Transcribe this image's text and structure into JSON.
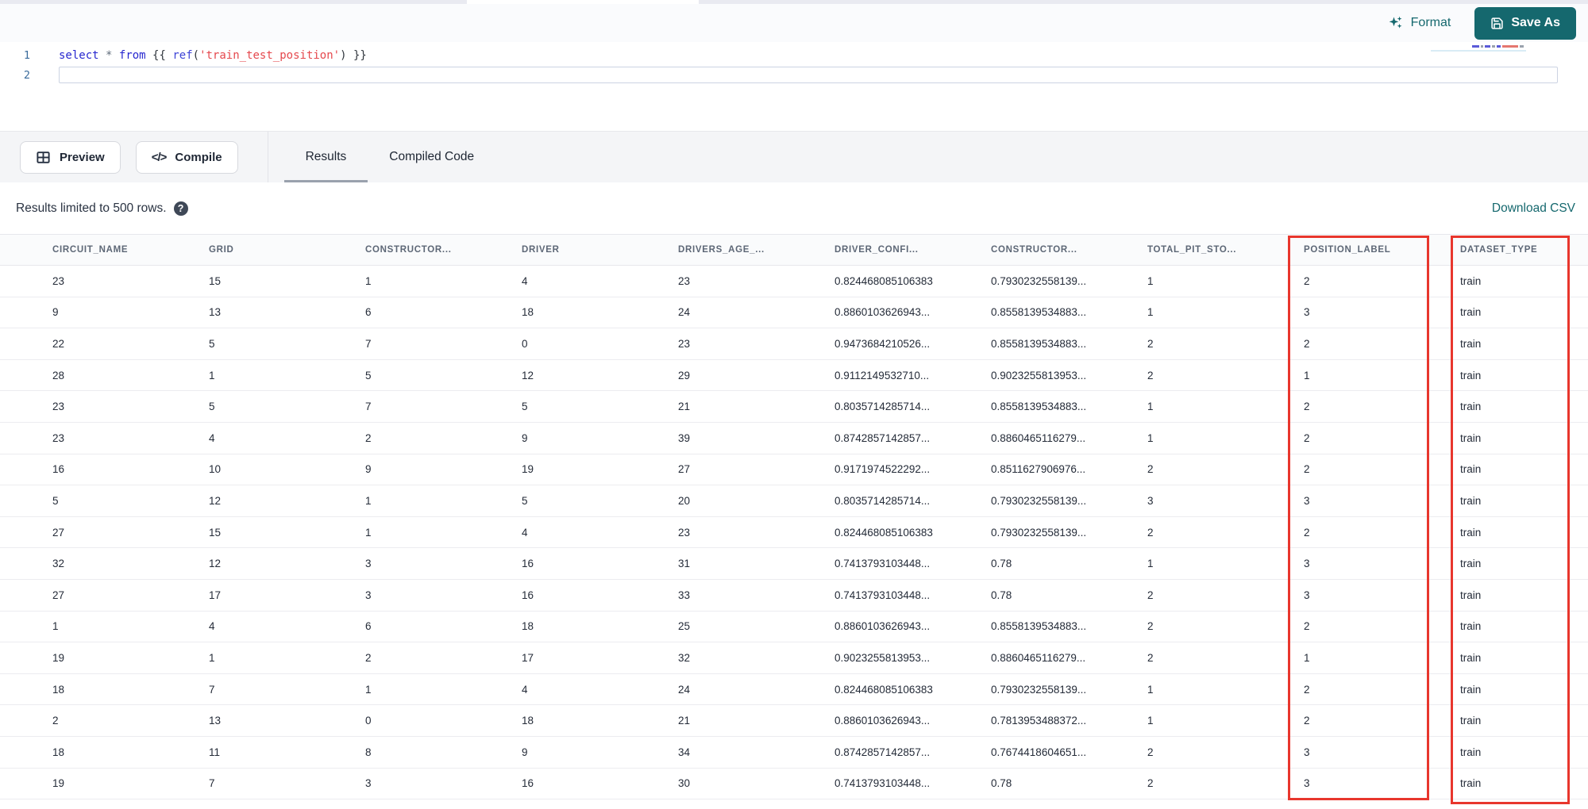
{
  "colors": {
    "accent": "#15686e",
    "highlight_red": "#e8362d"
  },
  "top_toolbar": {
    "format_label": "Format",
    "save_as_label": "Save As"
  },
  "editor": {
    "line_numbers": [
      "1",
      "2"
    ],
    "tokens": {
      "kw_select": "select",
      "op_star": "*",
      "kw_from": "from",
      "jinja_open": "{{",
      "fn_ref": "ref",
      "paren_open": "(",
      "str_model": "'train_test_position'",
      "paren_close": ")",
      "jinja_close": "}}"
    }
  },
  "actions": {
    "preview_label": "Preview",
    "compile_label": "Compile"
  },
  "tabs": [
    {
      "label": "Results",
      "active": true
    },
    {
      "label": "Compiled Code",
      "active": false
    }
  ],
  "results_bar": {
    "info": "Results limited to 500 rows.",
    "help_icon": "?",
    "download_label": "Download CSV"
  },
  "table": {
    "headers": [
      "CIRCUIT_NAME",
      "GRID",
      "CONSTRUCTOR...",
      "DRIVER",
      "DRIVERS_AGE_...",
      "DRIVER_CONFI...",
      "CONSTRUCTOR...",
      "TOTAL_PIT_STO...",
      "POSITION_LABEL",
      "DATASET_TYPE"
    ],
    "highlighted_columns": [
      "POSITION_LABEL",
      "DATASET_TYPE"
    ],
    "rows": [
      [
        "23",
        "15",
        "1",
        "4",
        "23",
        "0.824468085106383",
        "0.7930232558139...",
        "1",
        "2",
        "train"
      ],
      [
        "9",
        "13",
        "6",
        "18",
        "24",
        "0.8860103626943...",
        "0.8558139534883...",
        "1",
        "3",
        "train"
      ],
      [
        "22",
        "5",
        "7",
        "0",
        "23",
        "0.9473684210526...",
        "0.8558139534883...",
        "2",
        "2",
        "train"
      ],
      [
        "28",
        "1",
        "5",
        "12",
        "29",
        "0.9112149532710...",
        "0.9023255813953...",
        "2",
        "1",
        "train"
      ],
      [
        "23",
        "5",
        "7",
        "5",
        "21",
        "0.8035714285714...",
        "0.8558139534883...",
        "1",
        "2",
        "train"
      ],
      [
        "23",
        "4",
        "2",
        "9",
        "39",
        "0.8742857142857...",
        "0.8860465116279...",
        "1",
        "2",
        "train"
      ],
      [
        "16",
        "10",
        "9",
        "19",
        "27",
        "0.9171974522292...",
        "0.8511627906976...",
        "2",
        "2",
        "train"
      ],
      [
        "5",
        "12",
        "1",
        "5",
        "20",
        "0.8035714285714...",
        "0.7930232558139...",
        "3",
        "3",
        "train"
      ],
      [
        "27",
        "15",
        "1",
        "4",
        "23",
        "0.824468085106383",
        "0.7930232558139...",
        "2",
        "2",
        "train"
      ],
      [
        "32",
        "12",
        "3",
        "16",
        "31",
        "0.7413793103448...",
        "0.78",
        "1",
        "3",
        "train"
      ],
      [
        "27",
        "17",
        "3",
        "16",
        "33",
        "0.7413793103448...",
        "0.78",
        "2",
        "3",
        "train"
      ],
      [
        "1",
        "4",
        "6",
        "18",
        "25",
        "0.8860103626943...",
        "0.8558139534883...",
        "2",
        "2",
        "train"
      ],
      [
        "19",
        "1",
        "2",
        "17",
        "32",
        "0.9023255813953...",
        "0.8860465116279...",
        "2",
        "1",
        "train"
      ],
      [
        "18",
        "7",
        "1",
        "4",
        "24",
        "0.824468085106383",
        "0.7930232558139...",
        "1",
        "2",
        "train"
      ],
      [
        "2",
        "13",
        "0",
        "18",
        "21",
        "0.8860103626943...",
        "0.7813953488372...",
        "1",
        "2",
        "train"
      ],
      [
        "18",
        "11",
        "8",
        "9",
        "34",
        "0.8742857142857...",
        "0.7674418604651...",
        "2",
        "3",
        "train"
      ],
      [
        "19",
        "7",
        "3",
        "16",
        "30",
        "0.7413793103448...",
        "0.78",
        "2",
        "3",
        "train"
      ]
    ]
  }
}
